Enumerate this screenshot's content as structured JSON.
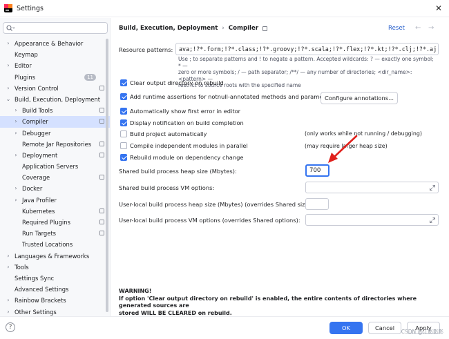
{
  "window": {
    "title": "Settings"
  },
  "search": {
    "placeholder": ""
  },
  "sidebar": {
    "items": [
      {
        "label": "Appearance & Behavior",
        "level": 0,
        "chevron": "›",
        "gear": false,
        "badge": ""
      },
      {
        "label": "Keymap",
        "level": 0,
        "chevron": "",
        "gear": false,
        "badge": ""
      },
      {
        "label": "Editor",
        "level": 0,
        "chevron": "›",
        "gear": false,
        "badge": ""
      },
      {
        "label": "Plugins",
        "level": 0,
        "chevron": "",
        "gear": false,
        "badge": "11"
      },
      {
        "label": "Version Control",
        "level": 0,
        "chevron": "›",
        "gear": true,
        "badge": ""
      },
      {
        "label": "Build, Execution, Deployment",
        "level": 0,
        "chevron": "⌄",
        "gear": false,
        "badge": ""
      },
      {
        "label": "Build Tools",
        "level": 1,
        "chevron": "›",
        "gear": true,
        "badge": ""
      },
      {
        "label": "Compiler",
        "level": 1,
        "chevron": "›",
        "gear": true,
        "badge": "",
        "selected": true
      },
      {
        "label": "Debugger",
        "level": 1,
        "chevron": "›",
        "gear": false,
        "badge": ""
      },
      {
        "label": "Remote Jar Repositories",
        "level": 1,
        "chevron": "",
        "gear": true,
        "badge": ""
      },
      {
        "label": "Deployment",
        "level": 1,
        "chevron": "›",
        "gear": true,
        "badge": ""
      },
      {
        "label": "Application Servers",
        "level": 1,
        "chevron": "",
        "gear": false,
        "badge": ""
      },
      {
        "label": "Coverage",
        "level": 1,
        "chevron": "",
        "gear": true,
        "badge": ""
      },
      {
        "label": "Docker",
        "level": 1,
        "chevron": "›",
        "gear": false,
        "badge": ""
      },
      {
        "label": "Java Profiler",
        "level": 1,
        "chevron": "›",
        "gear": false,
        "badge": ""
      },
      {
        "label": "Kubernetes",
        "level": 1,
        "chevron": "",
        "gear": true,
        "badge": ""
      },
      {
        "label": "Required Plugins",
        "level": 1,
        "chevron": "",
        "gear": true,
        "badge": ""
      },
      {
        "label": "Run Targets",
        "level": 1,
        "chevron": "",
        "gear": true,
        "badge": ""
      },
      {
        "label": "Trusted Locations",
        "level": 1,
        "chevron": "",
        "gear": false,
        "badge": ""
      },
      {
        "label": "Languages & Frameworks",
        "level": 0,
        "chevron": "›",
        "gear": false,
        "badge": ""
      },
      {
        "label": "Tools",
        "level": 0,
        "chevron": "›",
        "gear": false,
        "badge": ""
      },
      {
        "label": "Settings Sync",
        "level": 0,
        "chevron": "",
        "gear": false,
        "badge": ""
      },
      {
        "label": "Advanced Settings",
        "level": 0,
        "chevron": "",
        "gear": false,
        "badge": ""
      },
      {
        "label": "Rainbow Brackets",
        "level": 0,
        "chevron": "›",
        "gear": false,
        "badge": ""
      },
      {
        "label": "Other Settings",
        "level": 0,
        "chevron": "›",
        "gear": false,
        "badge": ""
      }
    ]
  },
  "header": {
    "breadcrumb_parent": "Build, Execution, Deployment",
    "breadcrumb_sep": "›",
    "breadcrumb_current": "Compiler",
    "reset_label": "Reset",
    "back_glyph": "←",
    "forward_glyph": "→"
  },
  "compiler": {
    "resource_patterns_label": "Resource patterns:",
    "resource_patterns_value": "ava;!?*.form;!?*.class;!?*.groovy;!?*.scala;!?*.flex;!?*.kt;!?*.clj;!?*.aj",
    "hint_line1": "Use ; to separate patterns and ! to negate a pattern. Accepted wildcards: ? — exactly one symbol; * —",
    "hint_line2": "zero or more symbols; / — path separator; /**/ — any number of directories; <dir_name>:<pattern> —",
    "hint_line3": "restrict to source roots with the specified name",
    "options": [
      {
        "label": "Clear output directory on rebuild",
        "checked": true,
        "note": ""
      },
      {
        "label": "Add runtime assertions for notnull-annotated methods and parameters",
        "checked": true,
        "note": ""
      },
      {
        "label": "Automatically show first error in editor",
        "checked": true,
        "note": ""
      },
      {
        "label": "Display notification on build completion",
        "checked": true,
        "note": ""
      },
      {
        "label": "Build project automatically",
        "checked": false,
        "note": "(only works while not running / debugging)"
      },
      {
        "label": "Compile independent modules in parallel",
        "checked": false,
        "note": "(may require larger heap size)"
      },
      {
        "label": "Rebuild module on dependency change",
        "checked": true,
        "note": ""
      }
    ],
    "configure_annotations_label": "Configure annotations...",
    "heap_label": "Shared build process heap size (Mbytes):",
    "heap_value": "700",
    "vm_options_label": "Shared build process VM options:",
    "user_heap_label": "User-local build process heap size (Mbytes) (overrides Shared size):",
    "user_vm_label": "User-local build process VM options (overrides Shared options):",
    "warning_title": "WARNING!",
    "warning_line1": "If option 'Clear output directory on rebuild' is enabled, the entire contents of directories where generated sources are",
    "warning_line2": "stored WILL BE CLEARED on rebuild."
  },
  "footer": {
    "help_glyph": "?",
    "ok_label": "OK",
    "cancel_label": "Cancel",
    "apply_label": "Apply",
    "watermark": "CSDN @江影影影"
  },
  "colors": {
    "accent": "#3574f0",
    "selected_row": "#d5e1ff",
    "arrow": "#e0201b",
    "link": "#2a61cc"
  }
}
